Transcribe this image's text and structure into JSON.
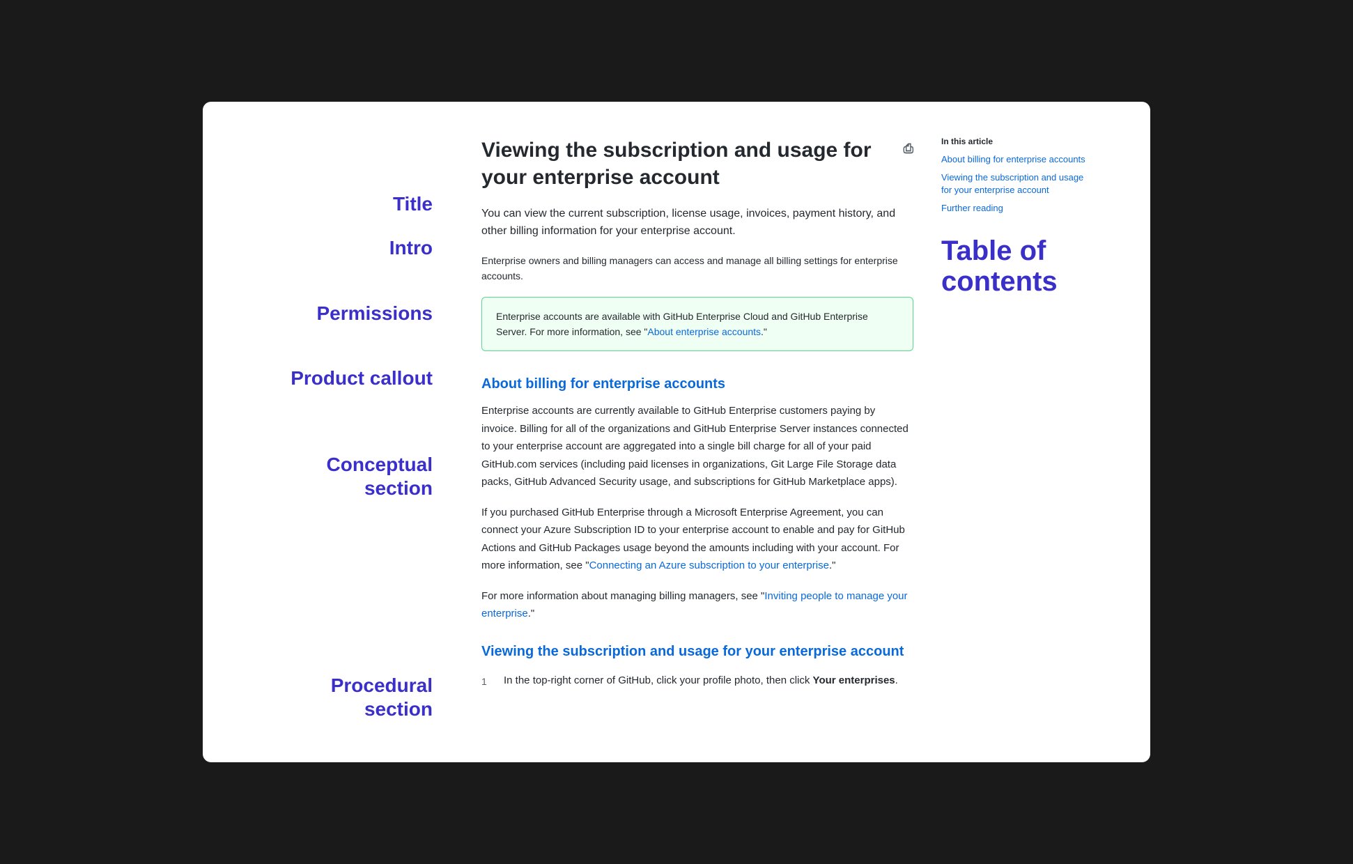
{
  "window": {
    "background": "#ffffff"
  },
  "annotations": {
    "title": "Title",
    "intro": "Intro",
    "permissions": "Permissions",
    "product_callout": "Product callout",
    "conceptual_section": "Conceptual section",
    "procedural_section": "Procedural section"
  },
  "article": {
    "title": "Viewing the subscription and usage for your enterprise account",
    "print_icon": "🖨",
    "intro": "You can view the current subscription, license usage, invoices, payment history, and other billing information for your enterprise account.",
    "permissions": "Enterprise owners and billing managers can access and manage all billing settings for enterprise accounts.",
    "callout": {
      "text_before": "Enterprise accounts are available with GitHub Enterprise Cloud and GitHub Enterprise Server. For more information, see \"",
      "link_text": "About enterprise accounts",
      "text_after": ".\""
    },
    "conceptual": {
      "heading": "About billing for enterprise accounts",
      "para1": "Enterprise accounts are currently available to GitHub Enterprise customers paying by invoice. Billing for all of the organizations and GitHub Enterprise Server instances connected to your enterprise account are aggregated into a single bill charge for all of your paid GitHub.com services (including paid licenses in organizations, Git Large File Storage data packs, GitHub Advanced Security usage, and subscriptions for GitHub Marketplace apps).",
      "para2_before": "If you purchased GitHub Enterprise through a Microsoft Enterprise Agreement, you can connect your Azure Subscription ID to your enterprise account to enable and pay for GitHub Actions and GitHub Packages usage beyond the amounts including with your account. For more information, see \"",
      "para2_link": "Connecting an Azure subscription to your enterprise",
      "para2_after": ".\"",
      "para3_before": "For more information about managing billing managers, see \"",
      "para3_link": "Inviting people to manage your enterprise",
      "para3_after": ".\""
    },
    "procedural": {
      "heading": "Viewing the subscription and usage for your enterprise account",
      "steps": [
        {
          "number": "1",
          "text_before": "In the top-right corner of GitHub, click your profile photo, then click ",
          "bold_text": "Your enterprises",
          "text_after": "."
        }
      ]
    }
  },
  "toc": {
    "in_article_label": "In this article",
    "links": [
      "About billing for enterprise accounts",
      "Viewing the subscription and usage for your enterprise account",
      "Further reading"
    ],
    "big_label_line1": "Table of",
    "big_label_line2": "contents"
  }
}
